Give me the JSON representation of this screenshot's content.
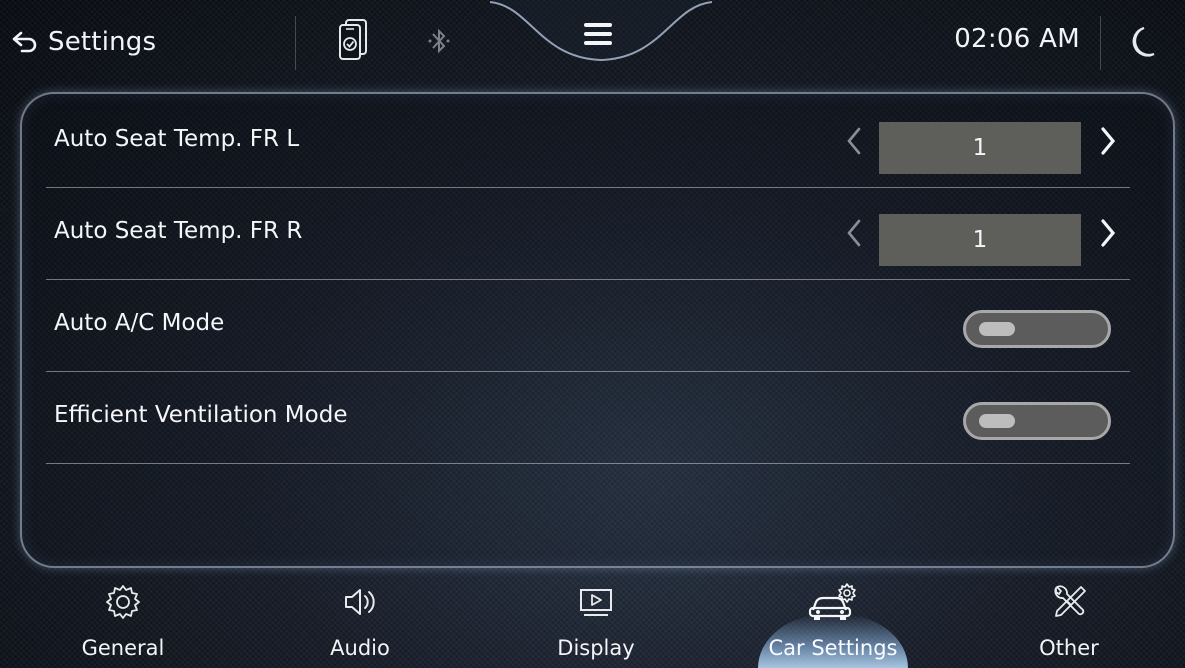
{
  "header": {
    "back_label": "Settings",
    "time": "02:06 AM",
    "icons": [
      "back-arrow-icon",
      "phone-connection-icon",
      "bluetooth-icon",
      "menu-icon",
      "moon-icon"
    ]
  },
  "settings": {
    "rows": [
      {
        "label": "Auto Seat Temp. FR L",
        "type": "stepper",
        "value": "1"
      },
      {
        "label": "Auto Seat Temp. FR R",
        "type": "stepper",
        "value": "1"
      },
      {
        "label": "Auto A/C Mode",
        "type": "toggle",
        "state": "off"
      },
      {
        "label": "Efficient Ventilation Mode",
        "type": "toggle",
        "state": "off"
      }
    ]
  },
  "nav": {
    "active": "Car Settings",
    "items": [
      {
        "label": "General",
        "icon": "gear-icon"
      },
      {
        "label": "Audio",
        "icon": "speaker-icon"
      },
      {
        "label": "Display",
        "icon": "display-icon"
      },
      {
        "label": "Car Settings",
        "icon": "car-gear-icon"
      },
      {
        "label": "Other",
        "icon": "tools-icon"
      }
    ]
  },
  "colors": {
    "background": "#0e131b",
    "panel_border": "#d2e1f5",
    "stepper_value_bg": "#5e5e5b",
    "toggle_bg": "#5c5c5c",
    "active_tab_glow": "#a0cdff"
  }
}
